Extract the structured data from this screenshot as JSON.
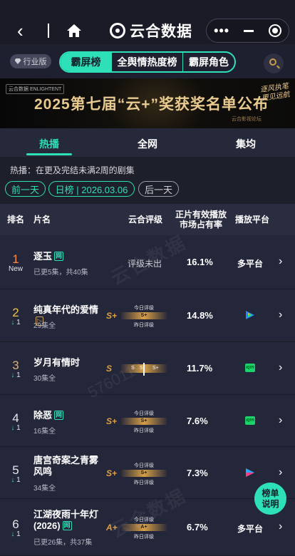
{
  "app": {
    "title": "云合数据",
    "icons": {
      "back": "chevron-left-icon",
      "home": "home-icon",
      "more": "more-dots-icon",
      "minimize": "minimize-icon",
      "close": "target-icon"
    }
  },
  "segbar": {
    "industry_label": "行业版",
    "tabs": [
      "霸屏榜",
      "全舆情热度榜",
      "霸屏角色"
    ],
    "active_tab": 0
  },
  "banner": {
    "logo_text": "云合数据 ENLIGHTENT",
    "title": "2025第七届“云+”奖获奖名单公布",
    "subtitle": "云合影视论坛",
    "script_text": "逐风执笔 更见远航"
  },
  "subtabs": {
    "items": [
      "热播",
      "全网",
      "集均"
    ],
    "active": 0
  },
  "info": {
    "description": "热播：在更及完结未满2周的剧集",
    "prev_day": "前一天",
    "current": "日榜 | 2026.03.06",
    "next_day": "后一天"
  },
  "table": {
    "headers": {
      "rank": "排名",
      "name": "片名",
      "rating": "云合评级",
      "share_line1": "正片有效播放",
      "share_line2": "市场占有率",
      "platform": "播放平台"
    },
    "rows": [
      {
        "rank": "1",
        "change": "New",
        "change_dir": "new",
        "name": "逐玉",
        "tag": "网",
        "tag_style": "green",
        "sub": "已更5集，共40集",
        "rating_type": "text",
        "rating_text": "评级未出",
        "share": "16.1%",
        "platform": "多平台",
        "platform_icon": ""
      },
      {
        "rank": "2",
        "change": "1",
        "change_dir": "down",
        "name": "纯真年代的爱情",
        "tag": "▷",
        "tag_style": "gold",
        "sub": "29集全",
        "rating_type": "gauge",
        "letter": "S+",
        "today_label": "今日评级",
        "today": "S+",
        "yesterday_label": "昨日评级",
        "share": "14.8%",
        "platform": "",
        "platform_icon": "tencent-video-icon"
      },
      {
        "rank": "3",
        "change": "1",
        "change_dir": "down",
        "name": "岁月有情时",
        "tag": "",
        "tag_style": "",
        "sub": "30集全",
        "rating_type": "triple",
        "letter": "S",
        "triple": [
          "S",
          "S",
          "S+"
        ],
        "share": "11.7%",
        "platform": "",
        "platform_icon": "iqiyi-icon"
      },
      {
        "rank": "4",
        "change": "1",
        "change_dir": "down",
        "name": "除恶",
        "tag": "网",
        "tag_style": "green",
        "sub": "16集全",
        "rating_type": "gauge",
        "letter": "S+",
        "today_label": "今日评级",
        "today": "S+",
        "yesterday_label": "昨日评级",
        "share": "7.6%",
        "platform": "",
        "platform_icon": "iqiyi-icon"
      },
      {
        "rank": "5",
        "change": "1",
        "change_dir": "down",
        "name": "唐宫奇案之青雾风鸣",
        "tag": "",
        "tag_style": "",
        "sub": "34集全",
        "rating_type": "gauge",
        "letter": "S+",
        "today_label": "今日评级",
        "today": "S+",
        "yesterday_label": "昨日评级",
        "share": "7.3%",
        "platform": "",
        "platform_icon": "youku-icon"
      },
      {
        "rank": "6",
        "change": "1",
        "change_dir": "down",
        "name": "江湖夜雨十年灯 (2026)",
        "tag": "网",
        "tag_style": "green",
        "sub": "已更26集，共37集",
        "rating_type": "gauge",
        "letter": "A+",
        "today_label": "今日评级",
        "today": "A+",
        "yesterday_label": "昨日评级",
        "share": "6.7%",
        "platform": "多平台",
        "platform_icon": ""
      }
    ]
  },
  "watermark": {
    "brand": "云合数据",
    "brand_en": "ENLIGHTENT",
    "number": "5760119"
  },
  "float_button": {
    "line1": "榜单",
    "line2": "说明"
  },
  "colors": {
    "accent": "#2de0b8",
    "gold": "#e0a040",
    "rank1": "#ff8a3d",
    "rank2": "#f0c24c",
    "rank3": "#d8b07e"
  }
}
